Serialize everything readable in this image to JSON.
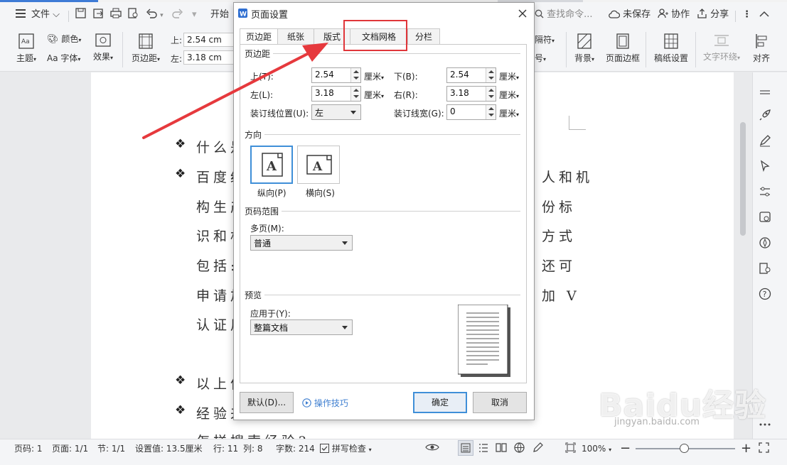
{
  "quickbar": {
    "file_label": "文件",
    "start_label": "开始",
    "search_placeholder": "查找命令...",
    "unsaved": "未保存",
    "collab": "协作",
    "share": "分享"
  },
  "ribbon": {
    "theme": "主题",
    "color": "颜色",
    "font": "字体",
    "effect": "效果",
    "margin": "页边距",
    "top_label": "上:",
    "top_value": "2.54 cm",
    "left_label": "左:",
    "left_value": "3.18 cm",
    "separator": "隔符",
    "number": "号",
    "background": "背景",
    "page_border": "页面边框",
    "paper_setup": "稿纸设置",
    "text_wrap": "文字环绕",
    "align": "对齐"
  },
  "document": {
    "lines": [
      "什么是",
      "百度经",
      "构生产",
      "识和机",
      "包括:",
      "申请加",
      "认证用",
      "以上信",
      "经验来",
      "怎样搜索经验?"
    ],
    "right_fragments": [
      "人和机",
      "份标",
      "方式",
      "还可",
      "加 V"
    ]
  },
  "dialog": {
    "title": "页面设置",
    "tabs": [
      "页边距",
      "纸张",
      "版式",
      "文档网格",
      "分栏"
    ],
    "margin_section": "页边距",
    "top_label": "上(T):",
    "top_value": "2.54",
    "bottom_label": "下(B):",
    "bottom_value": "2.54",
    "left_label": "左(L):",
    "left_value": "3.18",
    "right_label": "右(R):",
    "right_value": "3.18",
    "gutter_pos_label": "装订线位置(U):",
    "gutter_pos_value": "左",
    "gutter_width_label": "装订线宽(G):",
    "gutter_width_value": "0",
    "unit": "厘米",
    "orientation_section": "方向",
    "portrait": "纵向(P)",
    "landscape": "横向(S)",
    "page_range_section": "页码范围",
    "multi_page_label": "多页(M):",
    "multi_page_value": "普通",
    "preview_section": "预览",
    "apply_to_label": "应用于(Y):",
    "apply_to_value": "整篇文档",
    "default_btn": "默认(D)...",
    "tips_link": "操作技巧",
    "ok_btn": "确定",
    "cancel_btn": "取消"
  },
  "status": {
    "page_code": "页码: 1",
    "page": "页面: 1/1",
    "section": "节: 1/1",
    "setting": "设置值: 13.5厘米",
    "row": "行: 11",
    "col": "列: 8",
    "words": "字数: 214",
    "spell": "拼写检查",
    "zoom": "100%"
  },
  "watermark": {
    "brand": "Baidu经验",
    "url": "jingyan.baidu.com"
  },
  "colors": {
    "accent": "#3f8fd8",
    "annotation": "#e0363a"
  }
}
